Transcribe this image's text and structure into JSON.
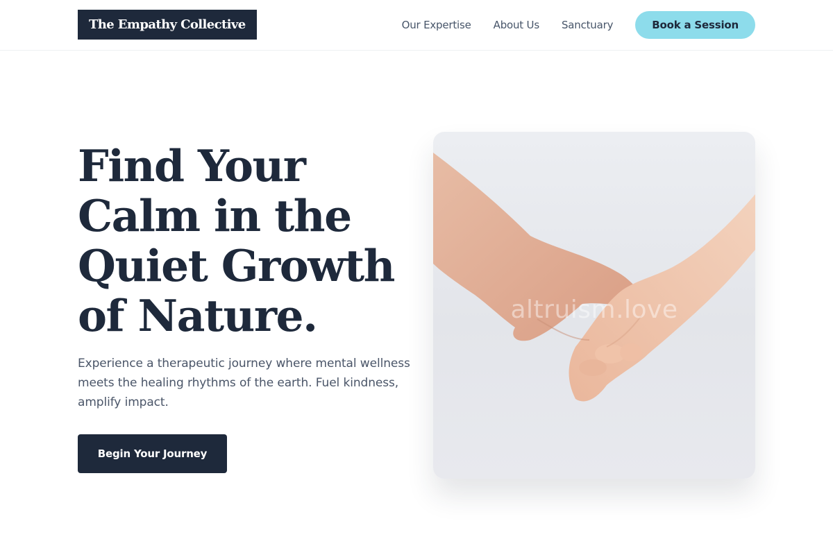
{
  "header": {
    "logo_text": "The Empathy Collective",
    "nav": {
      "expertise": "Our Expertise",
      "about": "About Us",
      "sanctuary": "Sanctuary"
    },
    "cta_label": "Book a Session"
  },
  "hero": {
    "title_lines": [
      "Find Your",
      "Calm in the",
      "Quiet Growth",
      "of Nature."
    ],
    "subtitle": "Experience a therapeutic journey where mental wellness meets the healing rhythms of the earth. Fuel kindness, amplify impact.",
    "cta_label": "Begin Your Journey",
    "image": {
      "watermark": "altruism.love"
    }
  },
  "colors": {
    "primary": "#1e293b",
    "accent": "#8ddceb",
    "muted_text": "#4a5568",
    "nav_text": "#475569"
  }
}
